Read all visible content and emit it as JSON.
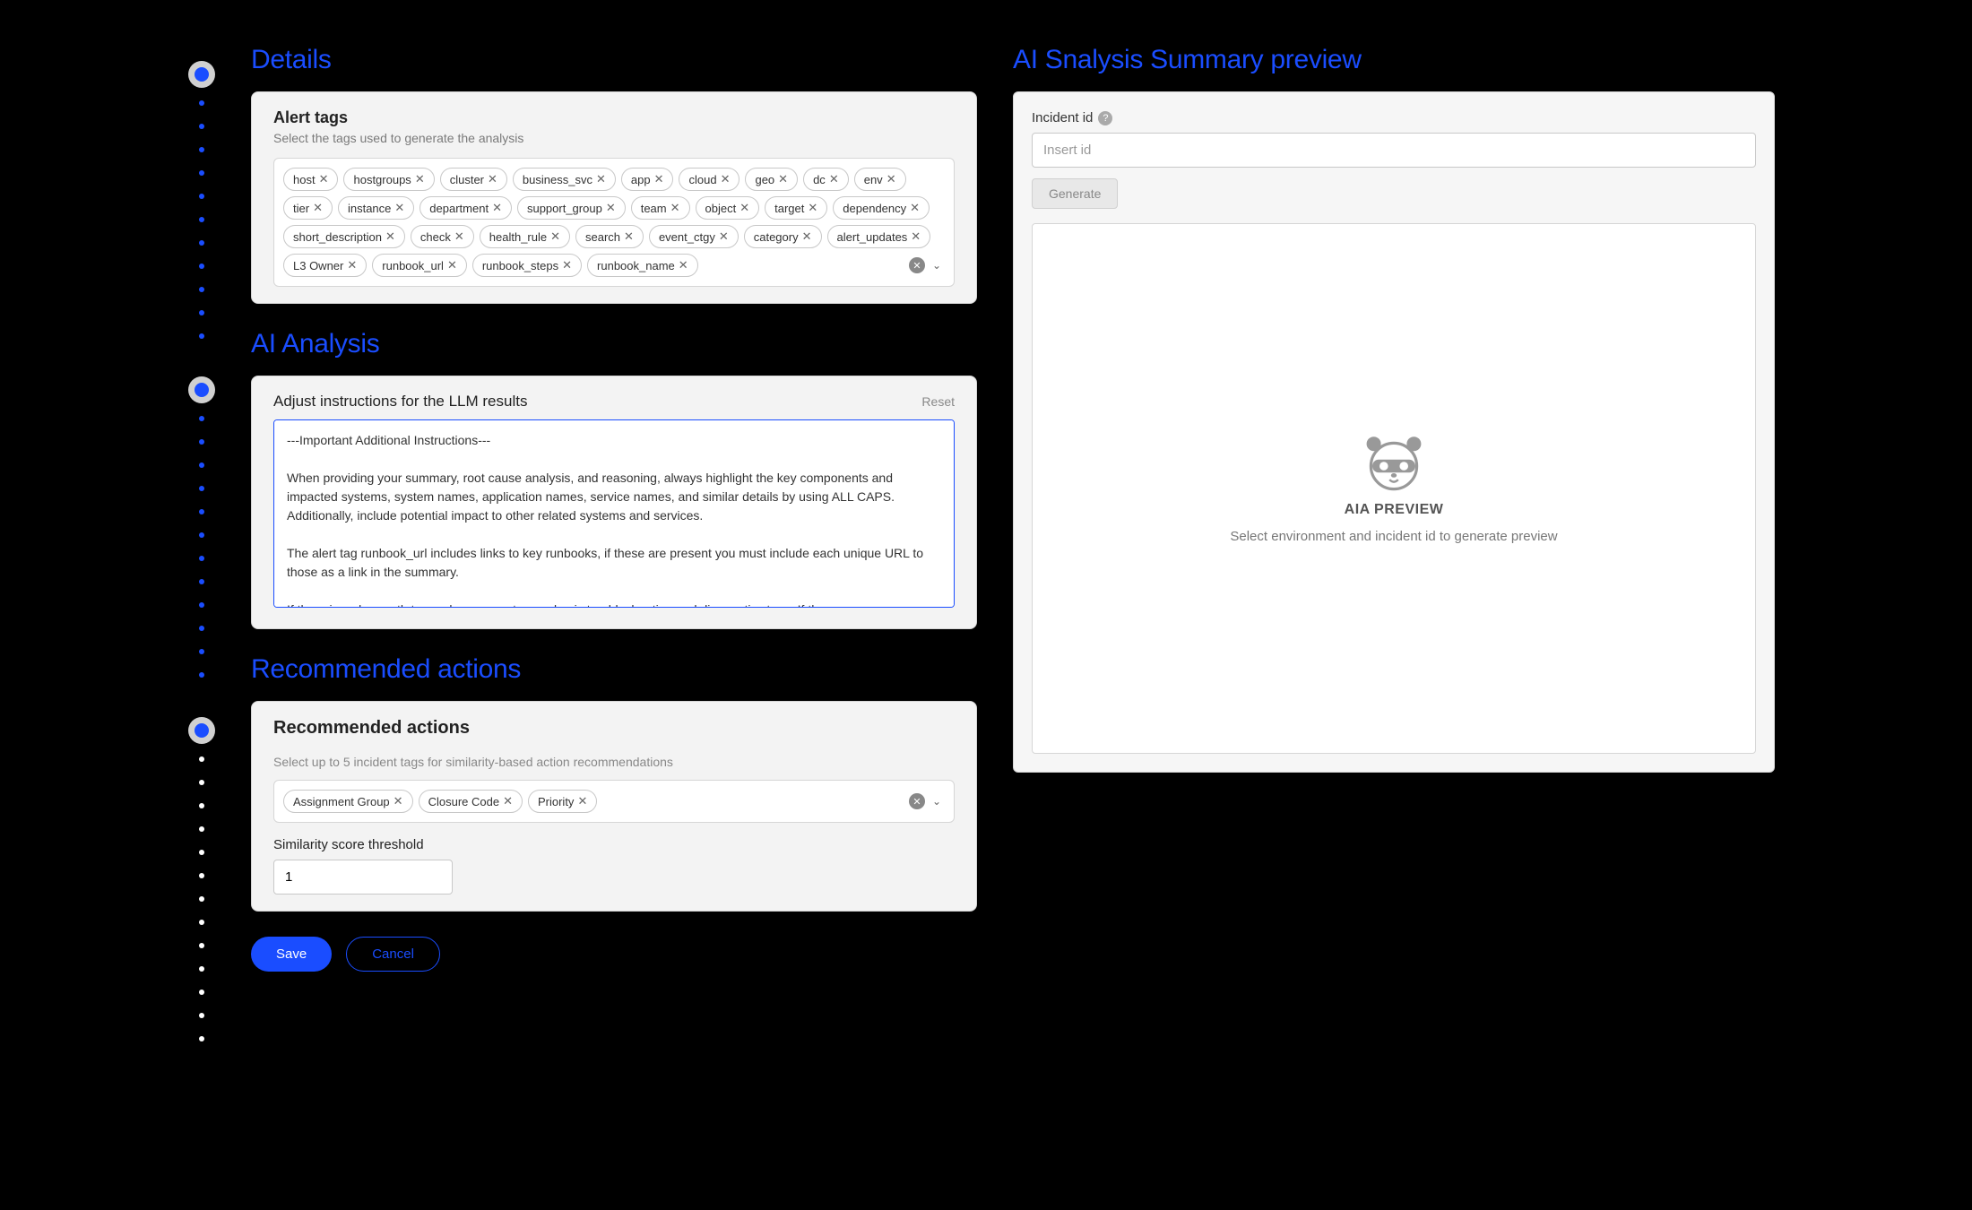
{
  "sections": {
    "details": "Details",
    "ai_analysis": "AI Analysis",
    "recommended": "Recommended actions"
  },
  "details_card": {
    "title": "Alert tags",
    "subtitle": "Select the tags used to generate the analysis",
    "tags": [
      "host",
      "hostgroups",
      "cluster",
      "business_svc",
      "app",
      "cloud",
      "geo",
      "dc",
      "env",
      "tier",
      "instance",
      "department",
      "support_group",
      "team",
      "object",
      "target",
      "dependency",
      "short_description",
      "check",
      "health_rule",
      "search",
      "event_ctgy",
      "category",
      "alert_updates",
      "L3 Owner",
      "runbook_url",
      "runbook_steps",
      "runbook_name"
    ]
  },
  "ai_card": {
    "title": "Adjust instructions for the LLM results",
    "reset": "Reset",
    "body": "---Important Additional Instructions---\n\nWhen providing your summary, root cause analysis, and reasoning, always highlight the key components and impacted systems, system names, application names, service names, and similar details by using ALL CAPS. Additionally, include potential impact to other related systems and services.\n\nThe alert tag runbook_url includes links to key runbooks, if these are present you must include each unique URL to those as a link in the summary.\n\nIf there is a clear path to resolve, suggest some basic troubleshooting and diagnostic steps. If the"
  },
  "rec_card": {
    "title": "Recommended actions",
    "subtitle": "Select up to 5 incident tags for similarity-based action recommendations",
    "tags": [
      "Assignment Group",
      "Closure Code",
      "Priority"
    ],
    "threshold_label": "Similarity score threshold",
    "threshold_value": "1"
  },
  "buttons": {
    "save": "Save",
    "cancel": "Cancel"
  },
  "preview": {
    "title": "AI Snalysis Summary preview",
    "incident_label": "Incident id",
    "incident_placeholder": "Insert id",
    "generate": "Generate",
    "empty_heading": "AIA PREVIEW",
    "empty_text": "Select environment and incident id to generate preview"
  }
}
